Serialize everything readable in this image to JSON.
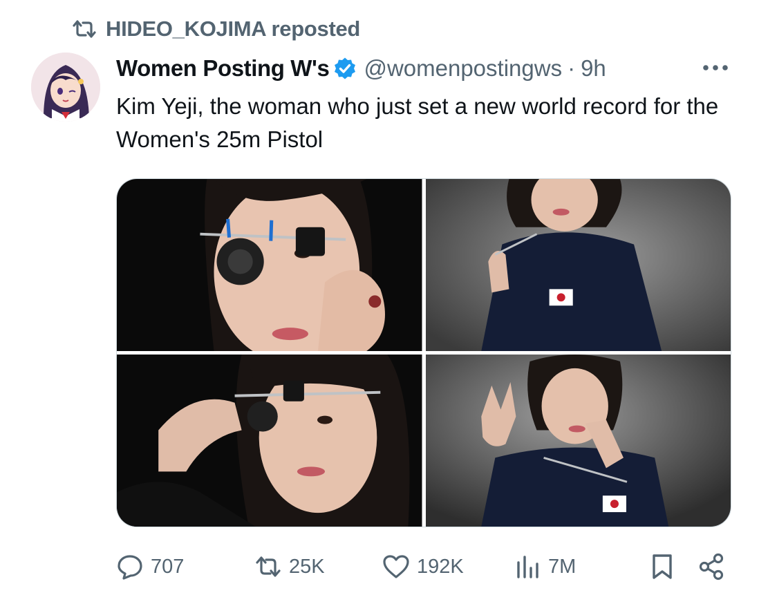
{
  "repost": {
    "icon": "repost-icon",
    "text": "HIDEO_KOJIMA reposted"
  },
  "author": {
    "avatar": "avatar-anime-character",
    "display_name": "Women Posting W's",
    "verified_icon": "verified-badge-icon",
    "handle": "@womenpostingws",
    "separator": "·",
    "time": "9h",
    "more_icon": "more-options-icon"
  },
  "tweet": {
    "text": "Kim Yeji, the woman who just set a new world record for the Women's 25m Pistol"
  },
  "media": [
    {
      "name": "photo-1"
    },
    {
      "name": "photo-2"
    },
    {
      "name": "photo-3"
    },
    {
      "name": "photo-4"
    }
  ],
  "actions": {
    "replies": "707",
    "reposts": "25K",
    "likes": "192K",
    "views": "7M"
  },
  "colors": {
    "text_primary": "#0f1419",
    "text_secondary": "#536471",
    "verified": "#1d9bf0",
    "border": "#cfd9de"
  }
}
